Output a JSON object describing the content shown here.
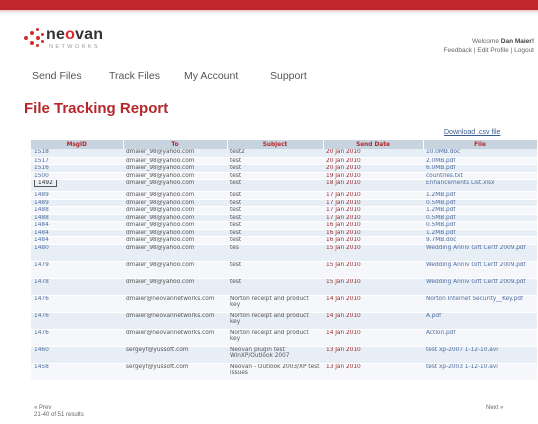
{
  "brand": {
    "name_part1": "ne",
    "name_o": "o",
    "name_part2": "van",
    "tagline": "NETWORKS"
  },
  "user": {
    "welcome": "Welcome",
    "name": "Dan Maier!",
    "links": [
      "Feedback",
      "Edit Profile",
      "Logout"
    ]
  },
  "nav": [
    "Send Files",
    "Track Files",
    "My Account",
    "Support"
  ],
  "page_title": "File Tracking Report",
  "download_link": "Download .csv file",
  "table": {
    "headers": [
      "MsgID",
      "To",
      "Subject",
      "Send Date",
      "File"
    ],
    "rows": [
      {
        "id": "1518",
        "to": "dmaier_98@yahoo.com",
        "subject": "test2",
        "date": "20 Jan 2010",
        "file": "10.0MB.doc"
      },
      {
        "id": "1517",
        "to": "dmaier_98@yahoo.com",
        "subject": "test",
        "date": "20 Jan 2010",
        "file": "2.0MB.pdf"
      },
      {
        "id": "1516",
        "to": "dmaier_98@yahoo.com",
        "subject": "test",
        "date": "20 Jan 2010",
        "file": "6.0MB.pdf"
      },
      {
        "id": "1500",
        "to": "dmaier_98@yahoo.com",
        "subject": "test",
        "date": "19 Jan 2010",
        "file": "countries.txt"
      },
      {
        "id": "1492",
        "to": "dmaier_98@yahoo.com",
        "subject": "test",
        "date": "18 Jan 2010",
        "file": "Enhancements List.xlsx",
        "boxed": true
      },
      {
        "id": "1489",
        "to": "dmaier_98@yahoo.com",
        "subject": "test",
        "date": "17 Jan 2010",
        "file": "1.2MB.pdf"
      },
      {
        "id": "1489",
        "to": "dmaier_98@yahoo.com",
        "subject": "test",
        "date": "17 Jan 2010",
        "file": "0.5MB.pdf"
      },
      {
        "id": "1488",
        "to": "dmaier_98@yahoo.com",
        "subject": "test",
        "date": "17 Jan 2010",
        "file": "1.2MB.pdf"
      },
      {
        "id": "1488",
        "to": "dmaier_98@yahoo.com",
        "subject": "test",
        "date": "17 Jan 2010",
        "file": "0.5MB.pdf"
      },
      {
        "id": "1484",
        "to": "dmaier_98@yahoo.com",
        "subject": "test",
        "date": "16 Jan 2010",
        "file": "0.5MB.pdf"
      },
      {
        "id": "1484",
        "to": "dmaier_98@yahoo.com",
        "subject": "test",
        "date": "16 Jan 2010",
        "file": "1.2MB.pdf"
      },
      {
        "id": "1484",
        "to": "dmaier_98@yahoo.com",
        "subject": "test",
        "date": "16 Jan 2010",
        "file": "9.7MB.doc"
      },
      {
        "id": "1480",
        "to": "dmaier_98@yahoo.com",
        "subject": "tes",
        "date": "15 Jan 2010",
        "file": "Wedding Anniv Gift Certf 2009.pdf"
      },
      {
        "id": "1479",
        "to": "dmaier_98@yahoo.com",
        "subject": "test",
        "date": "15 Jan 2010",
        "file": "Wedding Anniv Gift Certf 2009.pdf"
      },
      {
        "id": "1478",
        "to": "dmaier_98@yahoo.com",
        "subject": "test",
        "date": "15 Jan 2010",
        "file": "Wedding Anniv Gift Certf 2009.pdf"
      },
      {
        "id": "1476",
        "to": "dmaier@neovannetworks.com",
        "subject": "Norton receipt and product key",
        "date": "14 Jan 2010",
        "file": "Norton Internet Security__Key.pdf"
      },
      {
        "id": "1476",
        "to": "dmaier@neovannetworks.com",
        "subject": "Norton receipt and product key",
        "date": "14 Jan 2010",
        "file": "A.pdf"
      },
      {
        "id": "1476",
        "to": "dmaier@neovannetworks.com",
        "subject": "Norton receipt and product key",
        "date": "14 Jan 2010",
        "file": "Action.pdf"
      },
      {
        "id": "1460",
        "to": "sergeyf@yussoft.com",
        "subject": "Neovan plugin test WinXP/Outlook 2007",
        "date": "13 Jan 2010",
        "file": "test xp-2007 1-12-10.avi"
      },
      {
        "id": "1458",
        "to": "sergeyf@yussoft.com",
        "subject": "Neovan - Outlook 2003/XP test issues",
        "date": "13 Jan 2010",
        "file": "test xp-2003 1-12-10.avi"
      }
    ]
  },
  "pager": {
    "prev": "« Prev",
    "results": "21-40 of 51 results",
    "next": "Next »"
  }
}
